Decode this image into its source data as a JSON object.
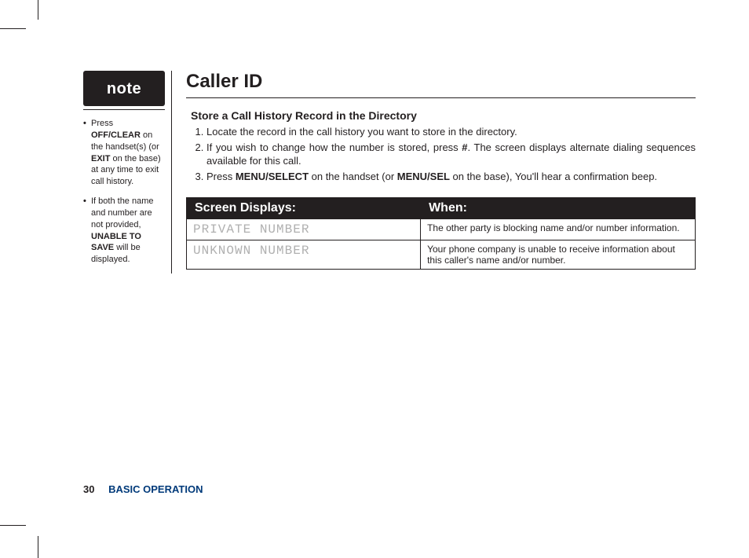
{
  "sidebar": {
    "note_label": "note",
    "items": [
      {
        "html": "Press <b>OFF/CLEAR</b> on the handset(s) (or <b>EXIT</b> on the base) at any time to exit call history."
      },
      {
        "html": "If both the name and number are not provided, <b>UNABLE TO SAVE</b> will be displayed."
      }
    ]
  },
  "main": {
    "title": "Caller ID",
    "sub_title": "Store a Call History Record in the Directory",
    "steps": [
      {
        "html": "Locate the record in the call history you want to store in the directory."
      },
      {
        "html": "If you wish to change how the number is stored, press <b>#</b>. The screen displays alternate dialing sequences available for this call."
      },
      {
        "html": "Press <b>MENU/SELECT</b> on the handset (or <b>MENU/SEL</b> on the base), You'll hear a confirmation beep."
      }
    ],
    "table": {
      "head": {
        "c1": "Screen Displays:",
        "c2": "When:"
      },
      "rows": [
        {
          "display": "PRIVATE NUMBER",
          "when": "The other party is blocking name and/or number information."
        },
        {
          "display": "UNKNOWN NUMBER",
          "when": "Your phone company is unable to receive information about this caller's name and/or number."
        }
      ]
    }
  },
  "footer": {
    "page": "30",
    "chapter": "BASIC OPERATION"
  }
}
